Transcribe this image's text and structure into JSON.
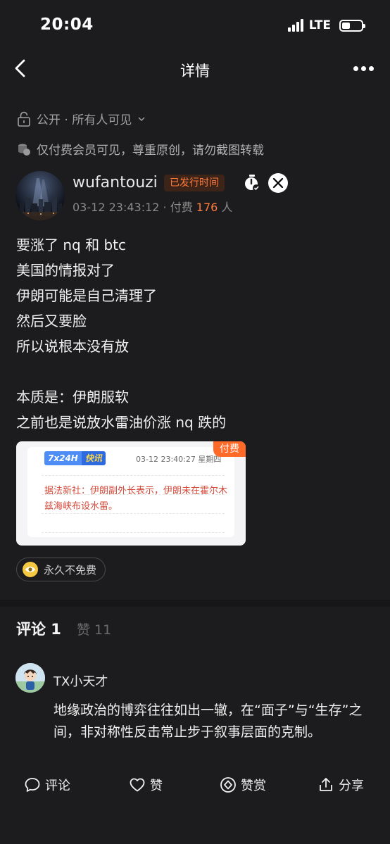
{
  "status_bar": {
    "time": "20:04",
    "network": "LTE"
  },
  "nav": {
    "title": "详情"
  },
  "visibility": {
    "label": "公开 · 所有人可见"
  },
  "paid_note": "仅付费会员可见，尊重原创，请勿截图转载",
  "author": {
    "name": "wufantouzi",
    "badge": "已发行时间",
    "meta_prefix": "03-12 23:43:12 · 付费 ",
    "paid_count": "176",
    "meta_suffix": " 人"
  },
  "post": {
    "lines": [
      "要涨了 nq 和 btc",
      "美国的情报对了",
      "伊朗可能是自己清理了",
      "然后又要脸",
      "所以说根本没有放",
      "",
      "本质是：伊朗服软",
      "之前也是说放水雷油价涨 nq 跌的"
    ]
  },
  "news_card": {
    "tag_a": "7x24H",
    "tag_b": "快讯",
    "time": "03-12 23:40:27 星期四",
    "text": "据法新社：伊朗副外长表示，伊朗未在霍尔木兹海峡布设水雷。",
    "paid_label": "付费"
  },
  "free_pill": {
    "label": "永久不免费"
  },
  "tabs": {
    "comments": "评论 1",
    "likes": "赞 11"
  },
  "comment": {
    "name": "TX小天才",
    "text": "地缘政治的博弈往往如出一辙，在“面子”与“生存”之间，非对称性反击常止步于叙事层面的克制。"
  },
  "bottom_bar": {
    "comment": "评论",
    "like": "赞",
    "reward": "赞赏",
    "share": "分享"
  },
  "colors": {
    "accent": "#ff7a3d",
    "background": "#1c1c1e"
  }
}
